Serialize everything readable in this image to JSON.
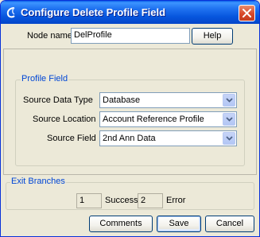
{
  "window": {
    "title": "Configure Delete Profile Field",
    "close_glyph": "✕",
    "icons": [
      "window-app-icon",
      "close-icon"
    ]
  },
  "node": {
    "label": "Node name",
    "value": "DelProfile",
    "help_label": "Help"
  },
  "profile_field": {
    "legend": "Profile Field",
    "source_data_type": {
      "label": "Source Data Type",
      "value": "Database"
    },
    "source_location": {
      "label": "Source Location",
      "value": "Account Reference Profile"
    },
    "source_field": {
      "label": "Source Field",
      "value": "2nd Ann Data"
    }
  },
  "exit_branches": {
    "legend": "Exit Branches",
    "items": [
      {
        "number": "1",
        "label": "Success"
      },
      {
        "number": "2",
        "label": "Error"
      }
    ]
  },
  "footer": {
    "comments_label": "Comments",
    "save_label": "Save",
    "cancel_label": "Cancel"
  },
  "colors": {
    "title_bar": "#0655dd",
    "legend_text": "#0046d5",
    "dialog_bg": "#ece9d8"
  }
}
